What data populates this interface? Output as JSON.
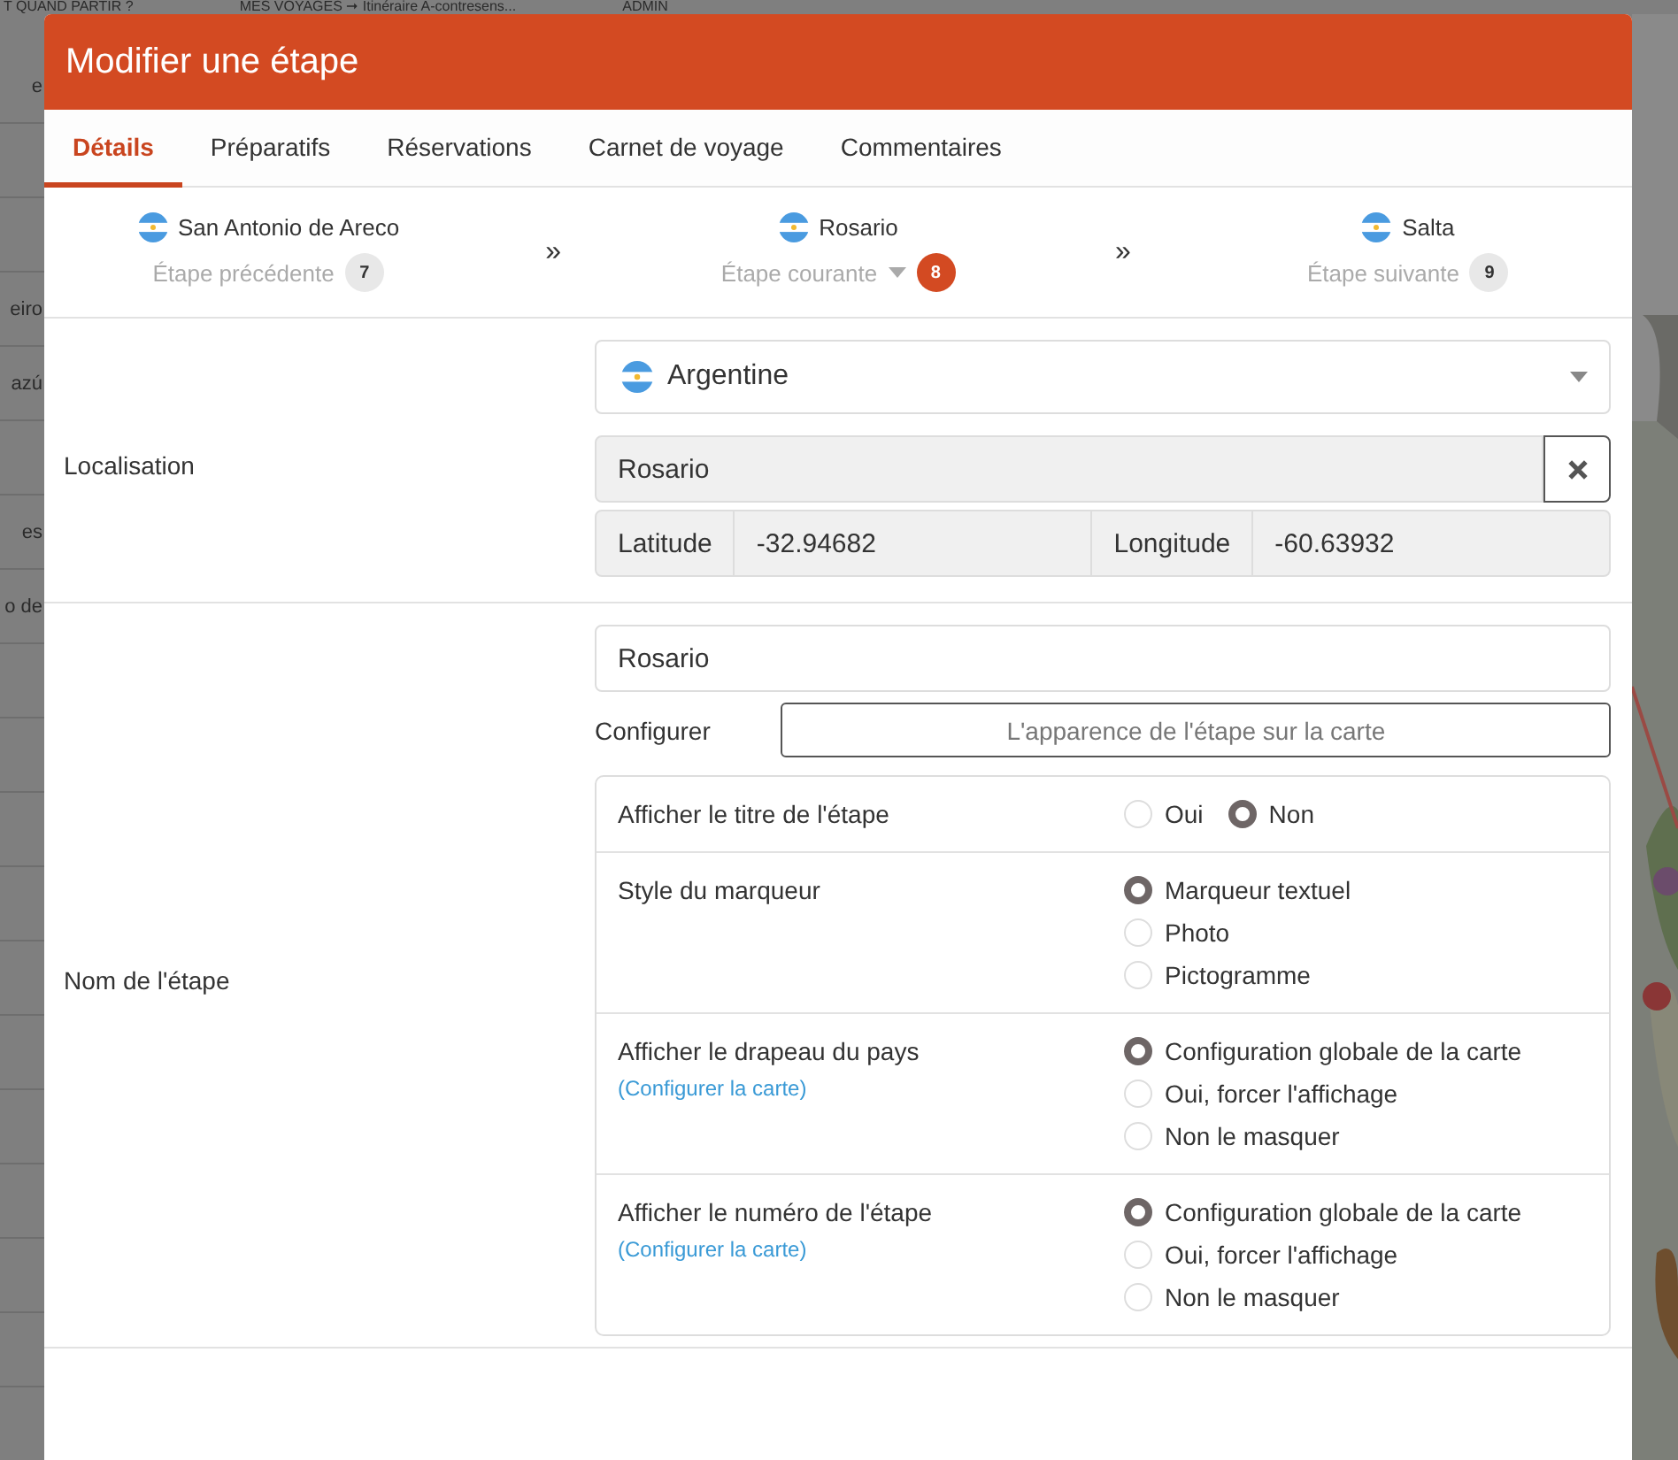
{
  "background_nav": [
    "T QUAND PARTIR ?",
    "MES VOYAGES ➞ Itinéraire A-contresens...",
    "ADMIN"
  ],
  "background_list": [
    {
      "text": "e"
    },
    {
      "text": "eiro"
    },
    {
      "text": "azú"
    },
    {
      "text": "es"
    },
    {
      "text": "o de"
    }
  ],
  "dialog": {
    "title": "Modifier une étape",
    "tabs": [
      {
        "label": "Détails",
        "selected": true
      },
      {
        "label": "Préparatifs",
        "selected": false
      },
      {
        "label": "Réservations",
        "selected": false
      },
      {
        "label": "Carnet de voyage",
        "selected": false
      },
      {
        "label": "Commentaires",
        "selected": false
      }
    ],
    "steps": [
      {
        "name": "San Antonio de Areco",
        "label": "Étape précédente",
        "number": "7",
        "current": false
      },
      {
        "name": "Rosario",
        "label": "Étape courante",
        "number": "8",
        "current": true
      },
      {
        "name": "Salta",
        "label": "Étape suivante",
        "number": "9",
        "current": false
      }
    ],
    "step_separator": "»",
    "location": {
      "label": "Localisation",
      "country": "Argentine",
      "place": "Rosario",
      "latitude_label": "Latitude",
      "latitude": "-32.94682",
      "longitude_label": "Longitude",
      "longitude": "-60.63932"
    },
    "step_name": {
      "label": "Nom de l'étape",
      "value": "Rosario",
      "configure_label": "Configurer",
      "configure_button": "L'apparence de l'étape sur la carte",
      "options": [
        {
          "label": "Afficher le titre de l'étape",
          "kind": "inline",
          "choices": [
            {
              "label": "Oui",
              "selected": false
            },
            {
              "label": "Non",
              "selected": true
            }
          ]
        },
        {
          "label": "Style du marqueur",
          "kind": "stacked",
          "choices": [
            {
              "label": "Marqueur textuel",
              "selected": true
            },
            {
              "label": "Photo",
              "selected": false
            },
            {
              "label": "Pictogramme",
              "selected": false
            }
          ]
        },
        {
          "label": "Afficher le drapeau du pays",
          "link": "(Configurer la carte)",
          "kind": "stacked",
          "choices": [
            {
              "label": "Configuration globale de la carte",
              "selected": true
            },
            {
              "label": "Oui, forcer l'affichage",
              "selected": false
            },
            {
              "label": "Non le masquer",
              "selected": false
            }
          ]
        },
        {
          "label": "Afficher le numéro de l'étape",
          "link": "(Configurer la carte)",
          "kind": "stacked",
          "choices": [
            {
              "label": "Configuration globale de la carte",
              "selected": true
            },
            {
              "label": "Oui, forcer l'affichage",
              "selected": false
            },
            {
              "label": "Non le masquer",
              "selected": false
            }
          ]
        }
      ]
    }
  }
}
